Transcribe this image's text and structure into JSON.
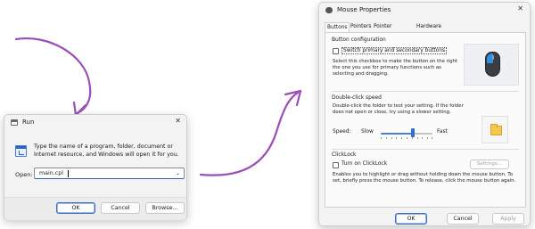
{
  "run": {
    "title": "Run",
    "description": "Type the name of a program, folder, document or Internet resource, and Windows will open it for you.",
    "open_label": "Open:",
    "open_value": "main.cpl",
    "ok_label": "OK",
    "cancel_label": "Cancel",
    "browse_label": "Browse..."
  },
  "mouse": {
    "title": "Mouse Properties",
    "tabs": [
      {
        "label": "Buttons",
        "active": true
      },
      {
        "label": "Pointers"
      },
      {
        "label": "Pointer Options"
      },
      {
        "label": "Hardware"
      }
    ],
    "button_config": {
      "title": "Button configuration",
      "checkbox_label": "Switch primary and secondary buttons",
      "checked": false,
      "description": "Select this checkbox to make the button on the right the one you use for primary functions such as selecting and dragging."
    },
    "double_click": {
      "title": "Double-click speed",
      "description": "Double-click the folder to test your setting. If the folder does not open or close, try using a slower setting.",
      "speed_label": "Speed:",
      "slow_label": "Slow",
      "fast_label": "Fast",
      "speed_fraction": 0.62
    },
    "clicklock": {
      "title": "ClickLock",
      "checkbox_label": "Turn on ClickLock",
      "checked": false,
      "settings_label": "Settings...",
      "description": "Enables you to highlight or drag without holding down the mouse button. To set, briefly press the mouse button. To release, click the mouse button again."
    },
    "ok_label": "OK",
    "cancel_label": "Cancel",
    "apply_label": "Apply"
  },
  "colors": {
    "arrow": "#9b4fb6",
    "accent": "#2f6fd4",
    "folder": "#f5c84c"
  },
  "icons": [
    "run-app-icon",
    "close-icon",
    "chevron-down-icon",
    "mouse-icon",
    "folder-icon",
    "mouse-image-icon"
  ]
}
